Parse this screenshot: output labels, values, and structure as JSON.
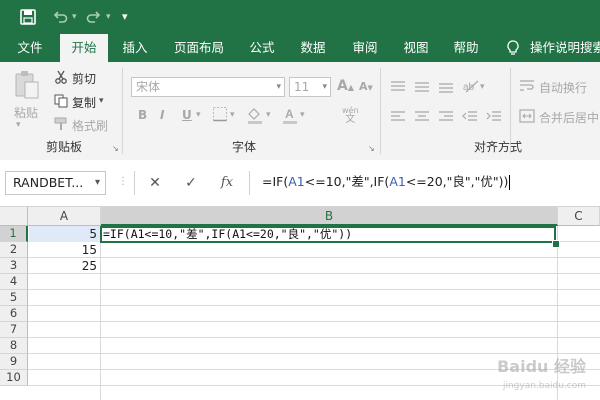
{
  "quick_access": {
    "save_icon": "save-icon",
    "undo_icon": "undo-icon",
    "redo_icon": "redo-icon",
    "customize_icon": "customize-icon"
  },
  "tabs": [
    {
      "label": "文件"
    },
    {
      "label": "开始"
    },
    {
      "label": "插入"
    },
    {
      "label": "页面布局"
    },
    {
      "label": "公式"
    },
    {
      "label": "数据"
    },
    {
      "label": "审阅"
    },
    {
      "label": "视图"
    },
    {
      "label": "帮助"
    }
  ],
  "tell_me": "操作说明搜索",
  "clipboard": {
    "paste": "粘贴",
    "cut": "剪切",
    "copy": "复制",
    "format_painter": "格式刷",
    "group_label": "剪贴板"
  },
  "font": {
    "font_name": "宋体",
    "font_size": "11",
    "bold": "B",
    "italic": "I",
    "underline": "U",
    "grow": "A",
    "shrink": "A",
    "phonetic": "wén",
    "group_label": "字体"
  },
  "alignment": {
    "wrap_text": "自动换行",
    "merge_center": "合并后居中",
    "group_label": "对齐方式"
  },
  "formula_bar": {
    "name_box": "RANDBET...",
    "cancel": "✕",
    "enter": "✓",
    "fx": "fx",
    "formula_parts": [
      "=IF(",
      "A1",
      "<=10,\"差\",IF(",
      "A1",
      "<=20,\"良\",\"优\"))"
    ]
  },
  "columns": [
    "A",
    "B",
    "C"
  ],
  "rows": [
    "1",
    "2",
    "3",
    "4",
    "5",
    "6",
    "7",
    "8",
    "9",
    "10"
  ],
  "cells": {
    "A1": "5",
    "A2": "15",
    "A3": "25"
  },
  "editing_text": "=IF(A1<=10,\"差\",IF(A1<=20,\"良\",\"优\"))",
  "watermark": {
    "line1": "Baidu 经验",
    "line2": "jingyan.baidu.com"
  },
  "colors": {
    "accent": "#217346",
    "cell_ref": "#3860b8",
    "selected_cell": "#dfe9f7"
  }
}
